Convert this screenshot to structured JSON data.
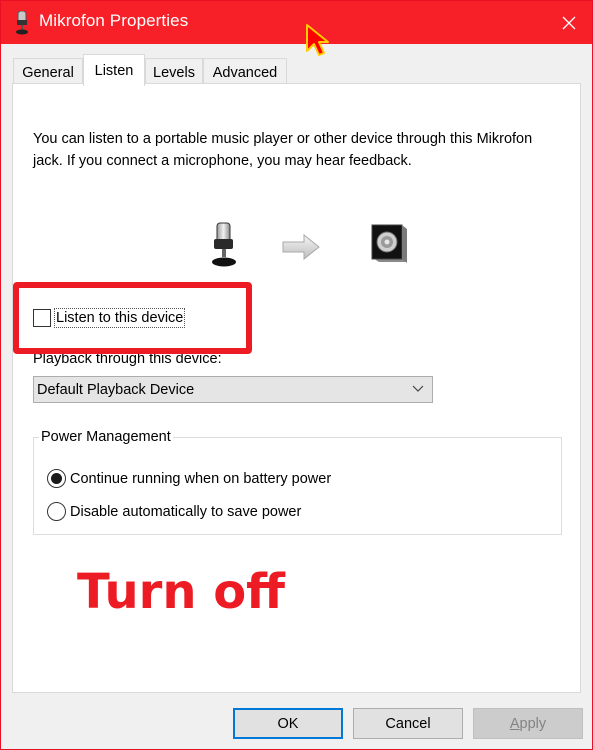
{
  "window": {
    "title": "Mikrofon Properties",
    "title_icon": "microphone-icon",
    "close_icon": "close-icon",
    "titlebar_color": "#f72028"
  },
  "tabs": [
    {
      "label": "General",
      "active": false
    },
    {
      "label": "Listen",
      "active": true
    },
    {
      "label": "Levels",
      "active": false
    },
    {
      "label": "Advanced",
      "active": false
    }
  ],
  "listen": {
    "description": "You can listen to a portable music player or other device through this Mikrofon jack.  If you connect a microphone, you may hear feedback.",
    "icons": [
      "microphone-icon",
      "arrow-right-icon",
      "speaker-icon"
    ],
    "checkbox_label": "Listen to this device",
    "checkbox_checked": false,
    "playback_label": "Playback through this device:",
    "playback_value": "Default Playback Device",
    "power": {
      "title": "Power Management",
      "options": [
        {
          "label": "Continue running when on battery power",
          "selected": true
        },
        {
          "label": "Disable automatically to save power",
          "selected": false
        }
      ]
    }
  },
  "annotation": {
    "text": "Turn off",
    "color": "#ed1c24"
  },
  "buttons": {
    "ok": "OK",
    "cancel": "Cancel",
    "apply": "Apply",
    "apply_accel": "A",
    "apply_rest": "pply"
  }
}
